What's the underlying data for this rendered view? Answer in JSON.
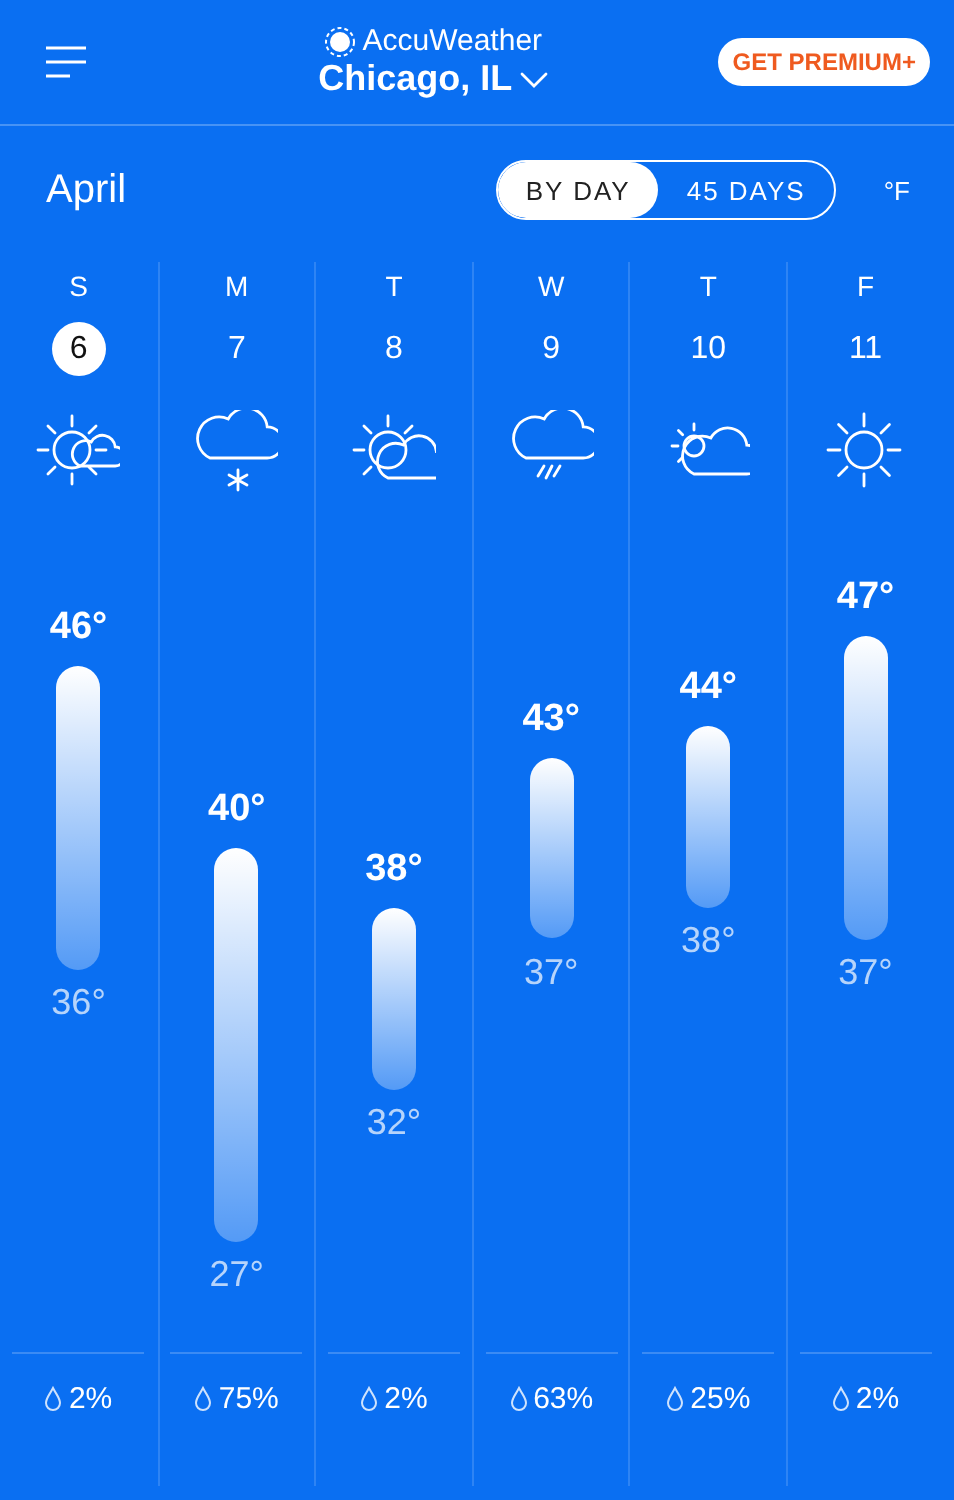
{
  "header": {
    "brand": "AccuWeather",
    "location": "Chicago, IL",
    "premium_button": "GET PREMIUM+"
  },
  "toolbar": {
    "month": "April",
    "views": [
      {
        "label": "BY DAY",
        "selected": true
      },
      {
        "label": "45 DAYS",
        "selected": false
      }
    ],
    "unit": "°F"
  },
  "days": [
    {
      "weekday": "S",
      "date": "6",
      "selected": true,
      "kind": "sun-cloud",
      "high": "46°",
      "low": "36°",
      "precip": "2%"
    },
    {
      "weekday": "M",
      "date": "7",
      "selected": false,
      "kind": "snow",
      "high": "40°",
      "low": "27°",
      "precip": "75%"
    },
    {
      "weekday": "T",
      "date": "8",
      "selected": false,
      "kind": "sun-cloud-large",
      "high": "38°",
      "low": "32°",
      "precip": "2%"
    },
    {
      "weekday": "W",
      "date": "9",
      "selected": false,
      "kind": "rain",
      "high": "43°",
      "low": "37°",
      "precip": "63%"
    },
    {
      "weekday": "T",
      "date": "10",
      "selected": false,
      "kind": "cloud-sun",
      "high": "44°",
      "low": "38°",
      "precip": "25%"
    },
    {
      "weekday": "F",
      "date": "11",
      "selected": false,
      "kind": "sun",
      "high": "47°",
      "low": "37°",
      "precip": "2%"
    }
  ]
}
